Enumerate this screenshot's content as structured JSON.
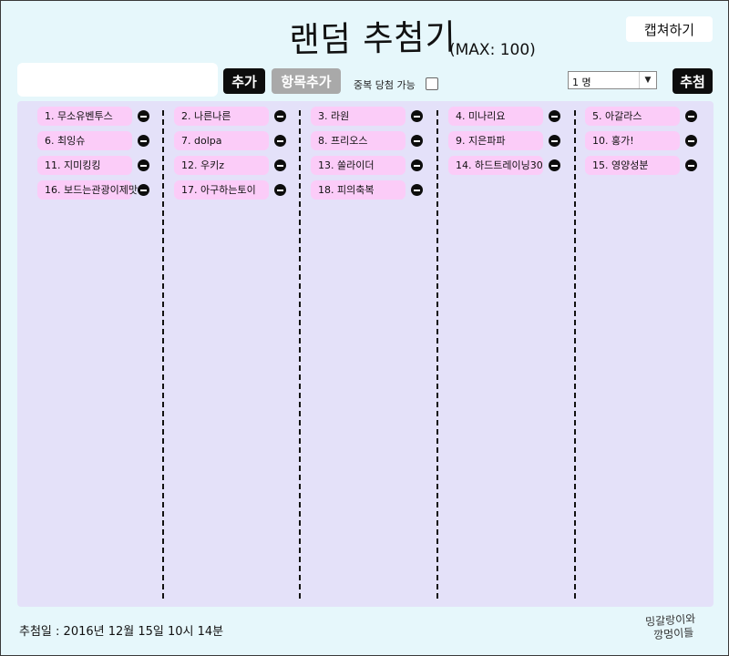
{
  "header": {
    "title": "랜덤 추첨기",
    "max_label": "(MAX: 100)",
    "capture_label": "캡쳐하기"
  },
  "toolbar": {
    "input_value": "",
    "input_placeholder": "",
    "add_label": "추가",
    "add_list_label": "항목추가",
    "duplicate_label": "중복 당첨 가능",
    "duplicate_checked": false,
    "count_selected": "1 명",
    "draw_label": "추첨"
  },
  "items": [
    "1. 무소유벤투스",
    "2. 나른나른",
    "3. 라원",
    "4. 미나리요",
    "5. 아갈라스",
    "6. 최잉슈",
    "7. dolpa",
    "8. 프리오스",
    "9. 지은파파",
    "10. 홍가!",
    "11. 지미킹킹",
    "12. 우키z",
    "13. 쏠라이더",
    "14. 하드트레이닝30",
    "15. 영양성분",
    "16. 보드는관광이제맛",
    "17. 아구하는토이",
    "18. 피의축복"
  ],
  "footer": {
    "date_label": "추첨일 :",
    "date_value": "2016년 12월 15일 10시 14분",
    "logo_line1": "밍갈랑이와",
    "logo_line2": "깡멍이들"
  },
  "colors": {
    "page_bg": "#e6f7fb",
    "board_bg": "#e4e1f9",
    "item_bg": "#fbccf8",
    "dark_button": "#0d0d0d",
    "disabled_button": "#a9a9a9"
  },
  "icons": {
    "remove": "minus-circle-icon",
    "dropdown": "caret-down-icon"
  }
}
